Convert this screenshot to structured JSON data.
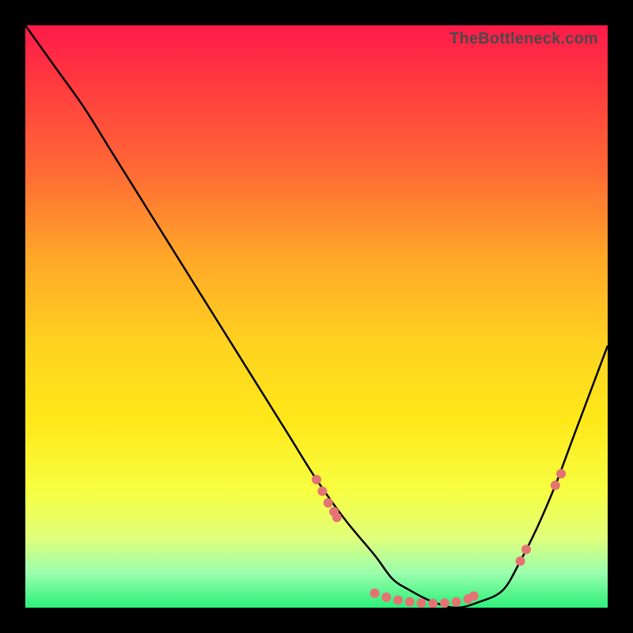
{
  "watermark": "TheBottleneck.com",
  "chart_data": {
    "type": "line",
    "title": "",
    "xlabel": "",
    "ylabel": "",
    "xlim": [
      0,
      100
    ],
    "ylim": [
      0,
      100
    ],
    "curve": {
      "name": "bottleneck-curve",
      "x": [
        0,
        5,
        10,
        15,
        20,
        25,
        30,
        35,
        40,
        45,
        50,
        55,
        60,
        63,
        66,
        70,
        74,
        78,
        82,
        85,
        88,
        91,
        94,
        97,
        100
      ],
      "y": [
        100,
        93,
        86,
        78,
        70,
        62,
        54,
        46,
        38,
        30,
        22,
        15,
        9,
        5,
        3,
        1,
        0,
        1,
        3,
        8,
        14,
        21,
        29,
        37,
        45
      ]
    },
    "markers": [
      {
        "x": 50,
        "y": 22
      },
      {
        "x": 51,
        "y": 20
      },
      {
        "x": 52,
        "y": 18
      },
      {
        "x": 53,
        "y": 16.5
      },
      {
        "x": 53.5,
        "y": 15.5
      },
      {
        "x": 60,
        "y": 2.5
      },
      {
        "x": 62,
        "y": 1.8
      },
      {
        "x": 64,
        "y": 1.3
      },
      {
        "x": 66,
        "y": 1.0
      },
      {
        "x": 68,
        "y": 0.8
      },
      {
        "x": 70,
        "y": 0.7
      },
      {
        "x": 72,
        "y": 0.8
      },
      {
        "x": 74,
        "y": 1.0
      },
      {
        "x": 76,
        "y": 1.5
      },
      {
        "x": 77,
        "y": 2.0
      },
      {
        "x": 85,
        "y": 8
      },
      {
        "x": 86,
        "y": 10
      },
      {
        "x": 91,
        "y": 21
      },
      {
        "x": 92,
        "y": 23
      }
    ],
    "colors": {
      "curve": "#000000",
      "marker": "#e57373"
    }
  }
}
